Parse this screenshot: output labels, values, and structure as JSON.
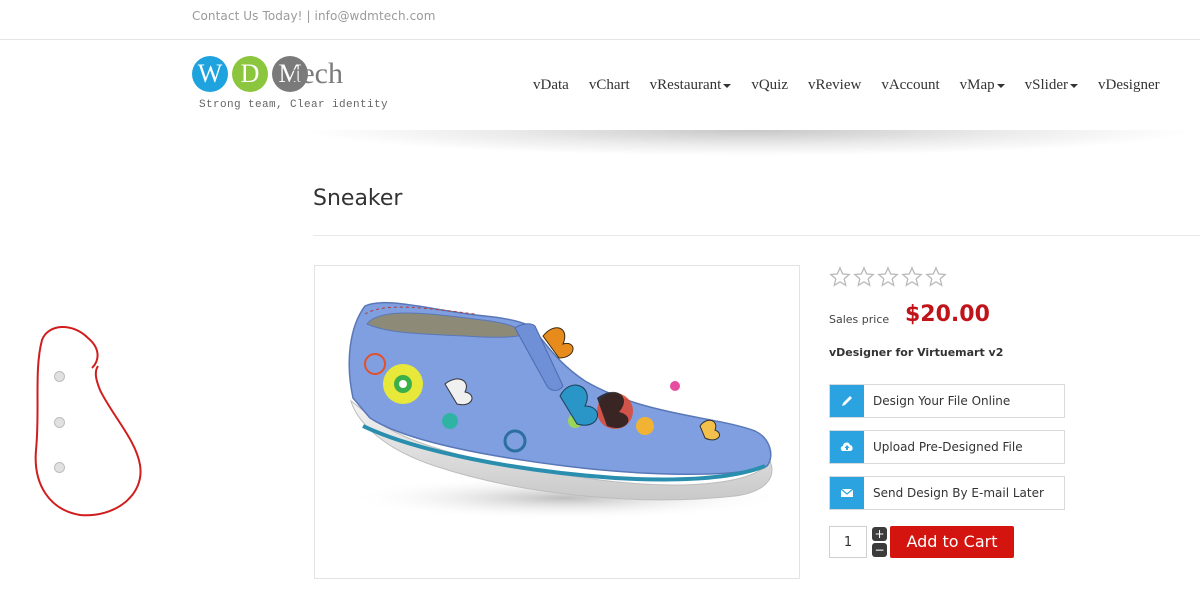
{
  "topbar": {
    "contact": "Contact Us Today! | info@wdmtech.com"
  },
  "logo": {
    "letters": [
      "W",
      "D",
      "M"
    ],
    "suffix": "tech",
    "tagline": "Strong team, Clear identity",
    "colors": [
      "#1ea3de",
      "#8cc63f",
      "#7a7a7a"
    ]
  },
  "nav": {
    "items": [
      {
        "label": "vData",
        "dropdown": false
      },
      {
        "label": "vChart",
        "dropdown": false
      },
      {
        "label": "vRestaurant",
        "dropdown": true
      },
      {
        "label": "vQuiz",
        "dropdown": false
      },
      {
        "label": "vReview",
        "dropdown": false
      },
      {
        "label": "vAccount",
        "dropdown": false
      },
      {
        "label": "vMap",
        "dropdown": true
      },
      {
        "label": "vSlider",
        "dropdown": true
      },
      {
        "label": "vDesigner",
        "dropdown": false
      }
    ]
  },
  "product": {
    "title": "Sneaker",
    "rating": 0,
    "rating_max": 5,
    "sales_label": "Sales price",
    "price": "$20.00",
    "subtitle": "vDesigner for Virtuemart v2",
    "actions": [
      {
        "label": "Design Your File Online",
        "icon": "pencil-icon"
      },
      {
        "label": "Upload Pre-Designed File",
        "icon": "cloud-upload-icon"
      },
      {
        "label": "Send Design By E-mail Later",
        "icon": "envelope-icon"
      }
    ],
    "quantity": "1",
    "qty_plus": "+",
    "qty_minus": "−",
    "add_to_cart": "Add to Cart"
  },
  "sidebar": {
    "radio_count": 3
  },
  "colors": {
    "accent_blue": "#2aa3e0",
    "price_red": "#c0141a",
    "cart_red": "#d4150f",
    "annotation_red": "#d01d1d"
  }
}
